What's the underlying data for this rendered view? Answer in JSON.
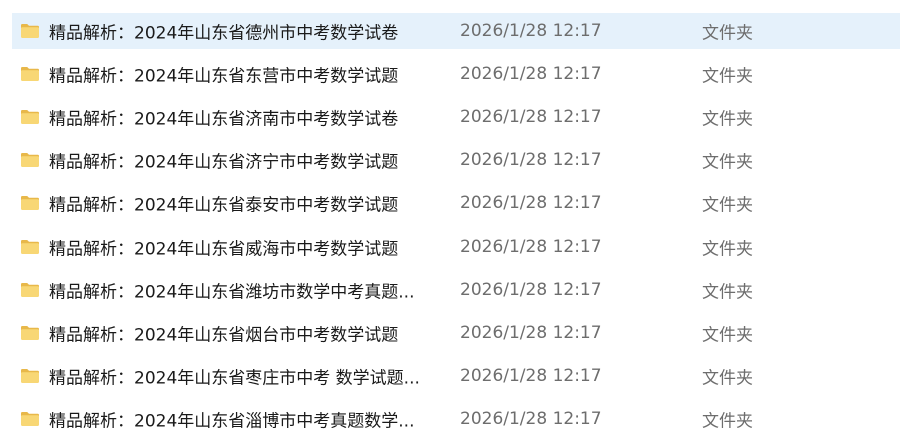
{
  "files": [
    {
      "name": "精品解析：2024年山东省德州市中考数学试卷",
      "modified": "2026/1/28 12:17",
      "type": "文件夹",
      "icon": "folder-icon",
      "selected": true
    },
    {
      "name": "精品解析：2024年山东省东营市中考数学试题",
      "modified": "2026/1/28 12:17",
      "type": "文件夹",
      "icon": "folder-icon",
      "selected": false
    },
    {
      "name": "精品解析：2024年山东省济南市中考数学试卷",
      "modified": "2026/1/28 12:17",
      "type": "文件夹",
      "icon": "folder-icon",
      "selected": false
    },
    {
      "name": "精品解析：2024年山东省济宁市中考数学试题",
      "modified": "2026/1/28 12:17",
      "type": "文件夹",
      "icon": "folder-icon",
      "selected": false
    },
    {
      "name": "精品解析：2024年山东省泰安市中考数学试题",
      "modified": "2026/1/28 12:17",
      "type": "文件夹",
      "icon": "folder-icon",
      "selected": false
    },
    {
      "name": "精品解析：2024年山东省威海市中考数学试题",
      "modified": "2026/1/28 12:17",
      "type": "文件夹",
      "icon": "folder-icon",
      "selected": false
    },
    {
      "name": "精品解析：2024年山东省潍坊市数学中考真题...",
      "modified": "2026/1/28 12:17",
      "type": "文件夹",
      "icon": "folder-icon",
      "selected": false
    },
    {
      "name": "精品解析：2024年山东省烟台市中考数学试题",
      "modified": "2026/1/28 12:17",
      "type": "文件夹",
      "icon": "folder-icon",
      "selected": false
    },
    {
      "name": "精品解析：2024年山东省枣庄市中考 数学试题...",
      "modified": "2026/1/28 12:17",
      "type": "文件夹",
      "icon": "folder-icon",
      "selected": false
    },
    {
      "name": "精品解析：2024年山东省淄博市中考真题数学...",
      "modified": "2026/1/28 12:17",
      "type": "文件夹",
      "icon": "folder-icon",
      "selected": false
    }
  ],
  "colors": {
    "selection_bg": "#e5f1fb",
    "folder_body": "#f8d775",
    "folder_tab": "#e8b84a",
    "name_text": "#1a1a1a",
    "meta_text": "#6d6d6d"
  }
}
